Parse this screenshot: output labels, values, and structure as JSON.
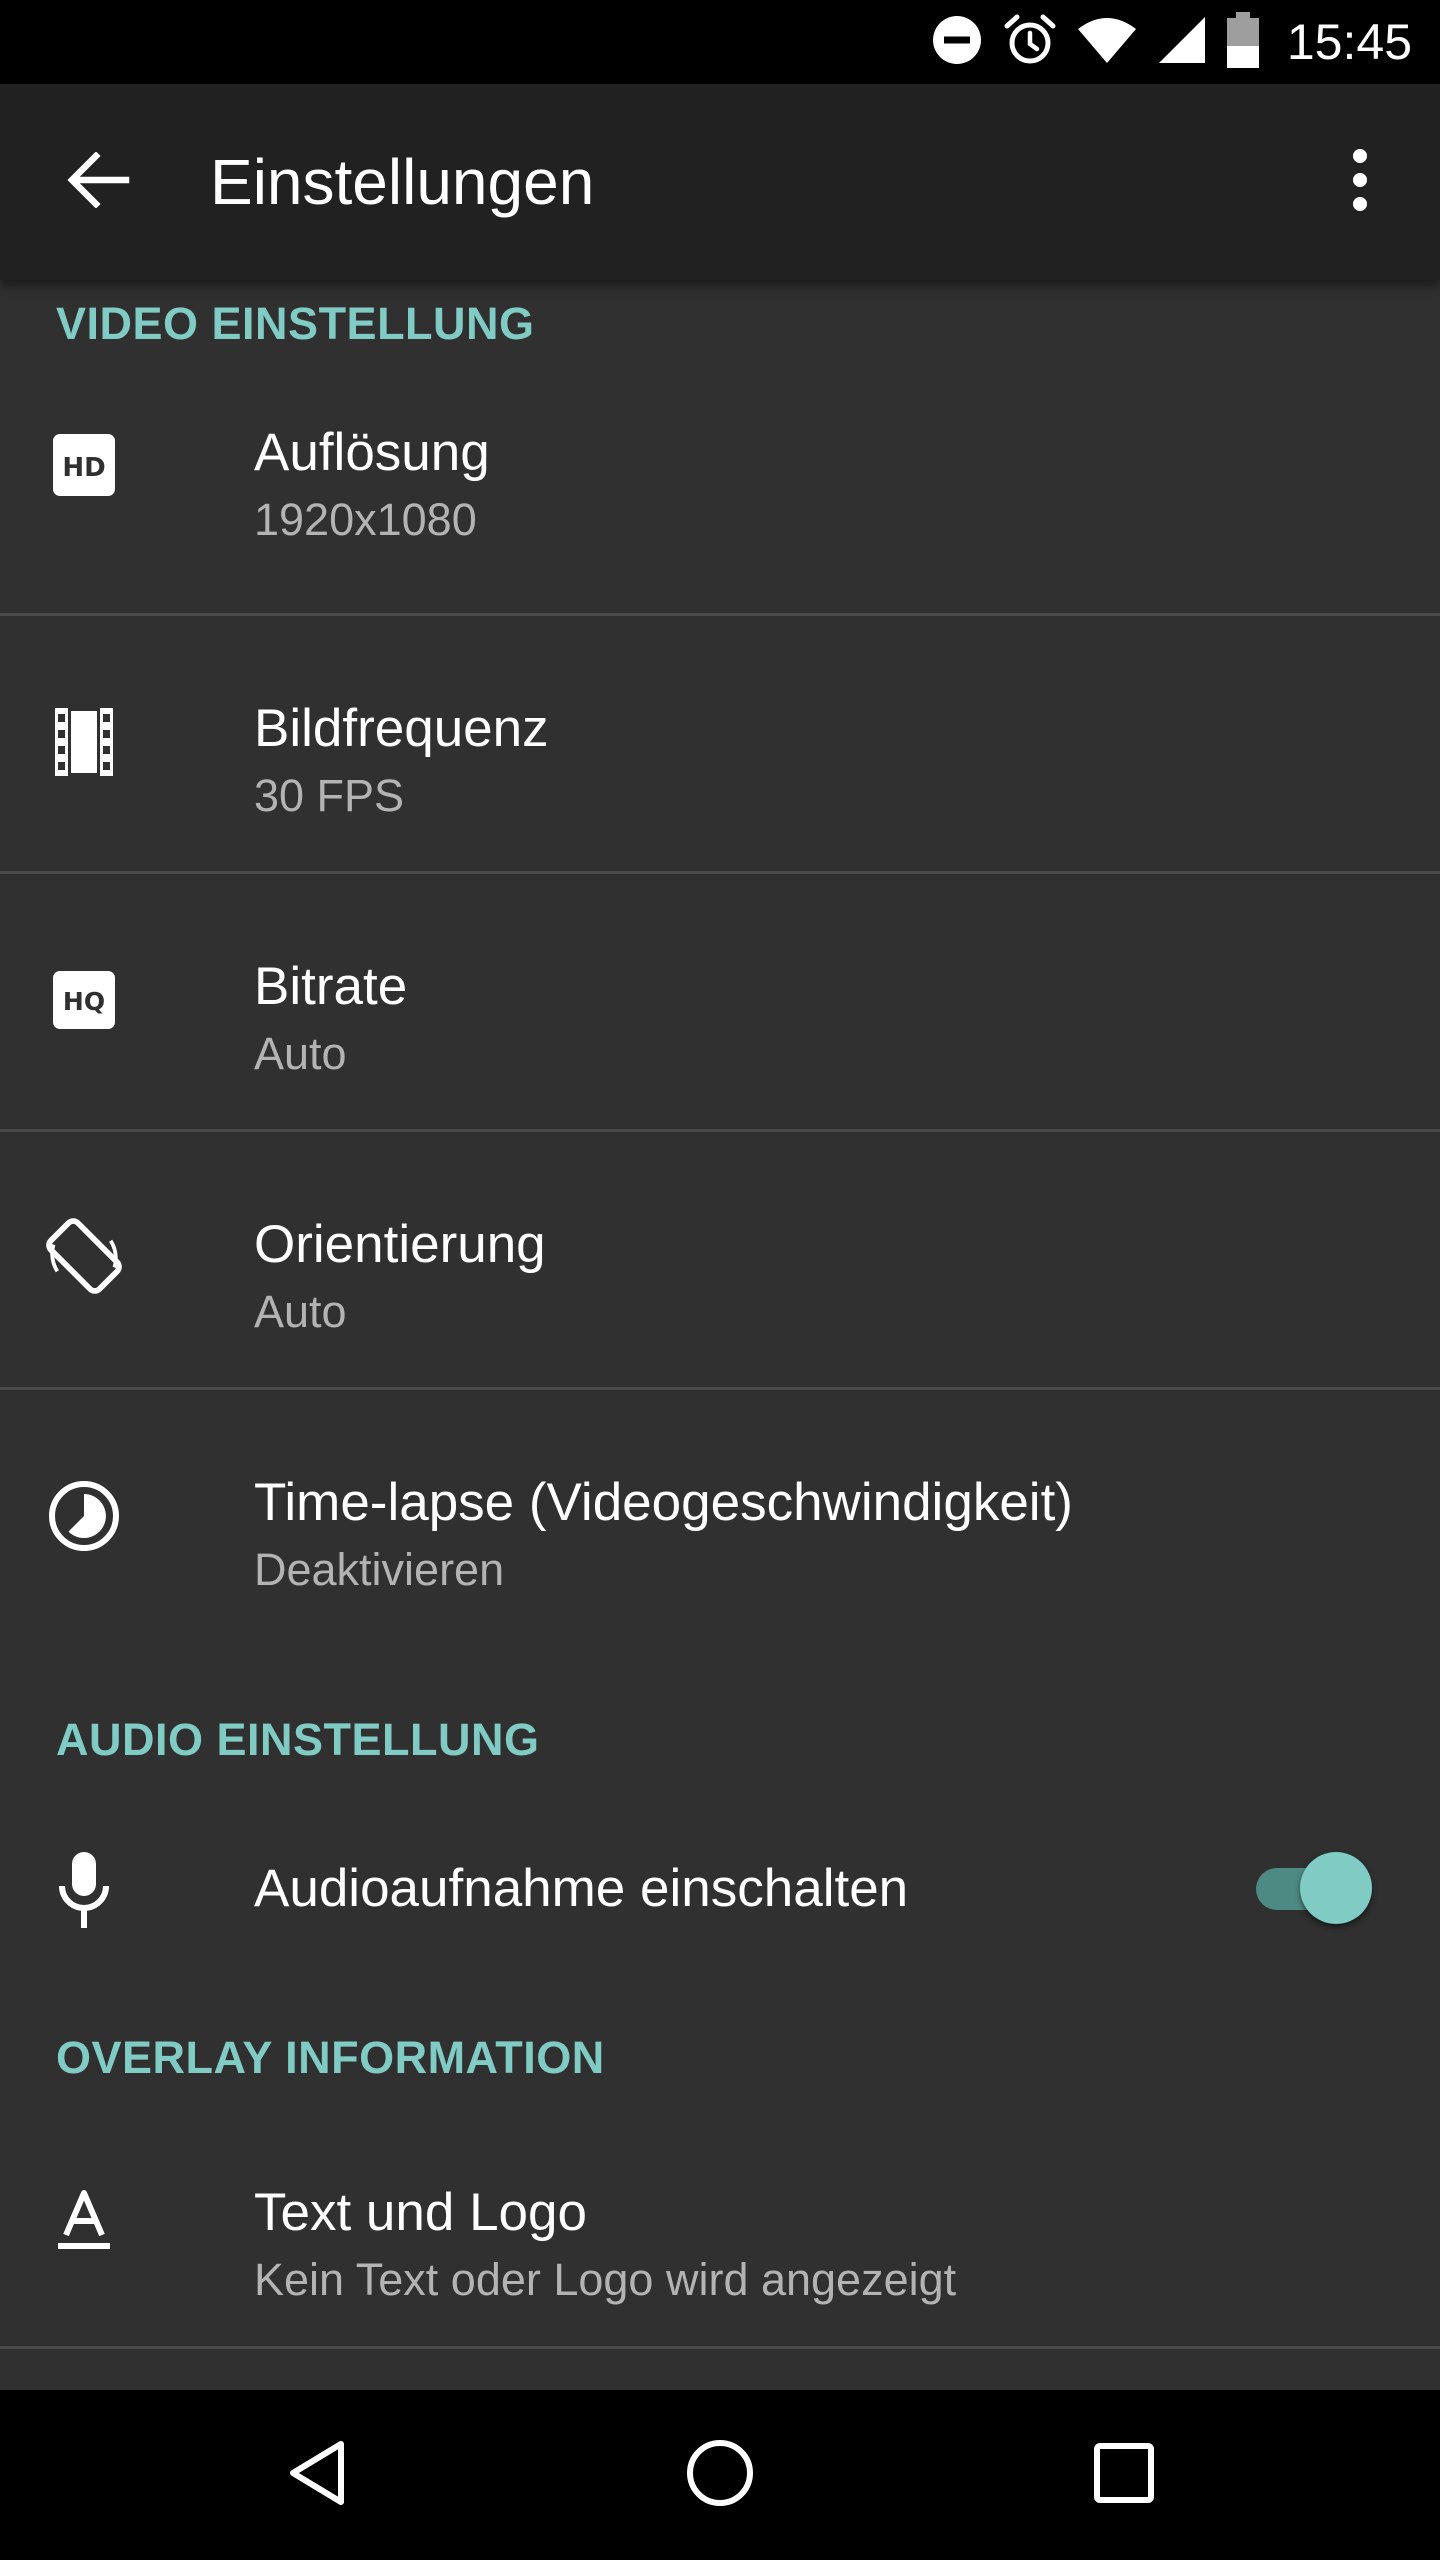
{
  "status_bar": {
    "time": "15:45",
    "icons": [
      "do-not-disturb-icon",
      "alarm-icon",
      "wifi-icon",
      "signal-icon",
      "battery-icon"
    ]
  },
  "app_bar": {
    "title": "Einstellungen",
    "back_icon": "arrow-back-icon",
    "menu_icon": "more-vert-icon"
  },
  "accent_color": "#80cbc4",
  "video_section": {
    "header": "VIDEO EINSTELLUNG",
    "items": [
      {
        "title": "Auflösung",
        "summary": "1920x1080",
        "icon": "hd-icon"
      },
      {
        "title": "Bildfrequenz",
        "summary": "30 FPS",
        "icon": "film-icon"
      },
      {
        "title": "Bitrate",
        "summary": "Auto",
        "icon": "hq-icon"
      },
      {
        "title": "Orientierung",
        "summary": "Auto",
        "icon": "screen-rotation-icon"
      },
      {
        "title": "Time-lapse (Videogeschwindigkeit)",
        "summary": "Deaktivieren",
        "icon": "timelapse-icon"
      }
    ]
  },
  "audio_section": {
    "header": "AUDIO EINSTELLUNG",
    "items": [
      {
        "title": "Audioaufnahme einschalten",
        "icon": "mic-icon",
        "switch_on": true
      }
    ]
  },
  "overlay_section": {
    "header": "OVERLAY INFORMATION",
    "items": [
      {
        "title": "Text und Logo",
        "summary": "Kein Text oder Logo wird angezeigt",
        "icon": "text-format-icon"
      }
    ]
  },
  "nav_bar": {
    "buttons": [
      "nav-back-icon",
      "nav-home-icon",
      "nav-recents-icon"
    ]
  }
}
